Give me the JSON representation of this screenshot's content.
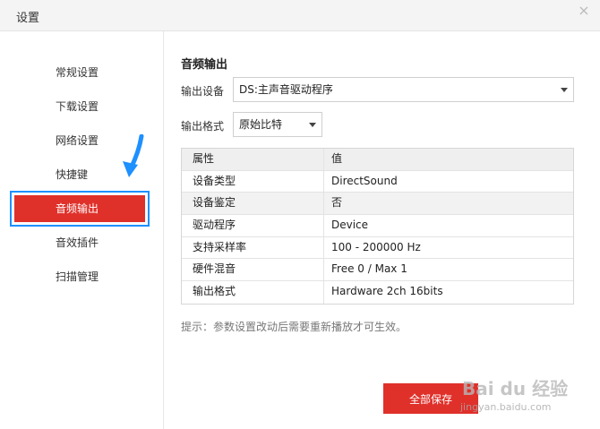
{
  "window": {
    "title": "设置",
    "close_glyph": "×"
  },
  "sidebar": {
    "items": [
      {
        "label": "常规设置",
        "active": false
      },
      {
        "label": "下载设置",
        "active": false
      },
      {
        "label": "网络设置",
        "active": false
      },
      {
        "label": "快捷键",
        "active": false
      },
      {
        "label": "音频输出",
        "active": true
      },
      {
        "label": "音效插件",
        "active": false
      },
      {
        "label": "扫描管理",
        "active": false
      }
    ]
  },
  "main": {
    "section_title": "音频输出",
    "output_device": {
      "label": "输出设备",
      "value": "DS:主声音驱动程序"
    },
    "output_format": {
      "label": "输出格式",
      "value": "原始比特"
    },
    "table": {
      "headers": [
        "属性",
        "值"
      ],
      "rows": [
        [
          "设备类型",
          "DirectSound"
        ],
        [
          "设备鉴定",
          "否"
        ],
        [
          "驱动程序",
          "Device"
        ],
        [
          "支持采样率",
          "100 - 200000 Hz"
        ],
        [
          "硬件混音",
          "Free 0 / Max 1"
        ],
        [
          "输出格式",
          "Hardware 2ch 16bits"
        ]
      ]
    },
    "hint": "提示：参数设置改动后需要重新播放才可生效。",
    "save_label": "全部保存"
  },
  "watermark": {
    "brand": "Bai du 经验",
    "url": "jingyan.baidu.com"
  },
  "colors": {
    "accent": "#e0302a",
    "highlight_outline": "#1e90ff"
  },
  "icons": {
    "close": "close-icon",
    "select_caret": "chevron-down-icon",
    "annotation": "arrow-annotation-icon"
  }
}
